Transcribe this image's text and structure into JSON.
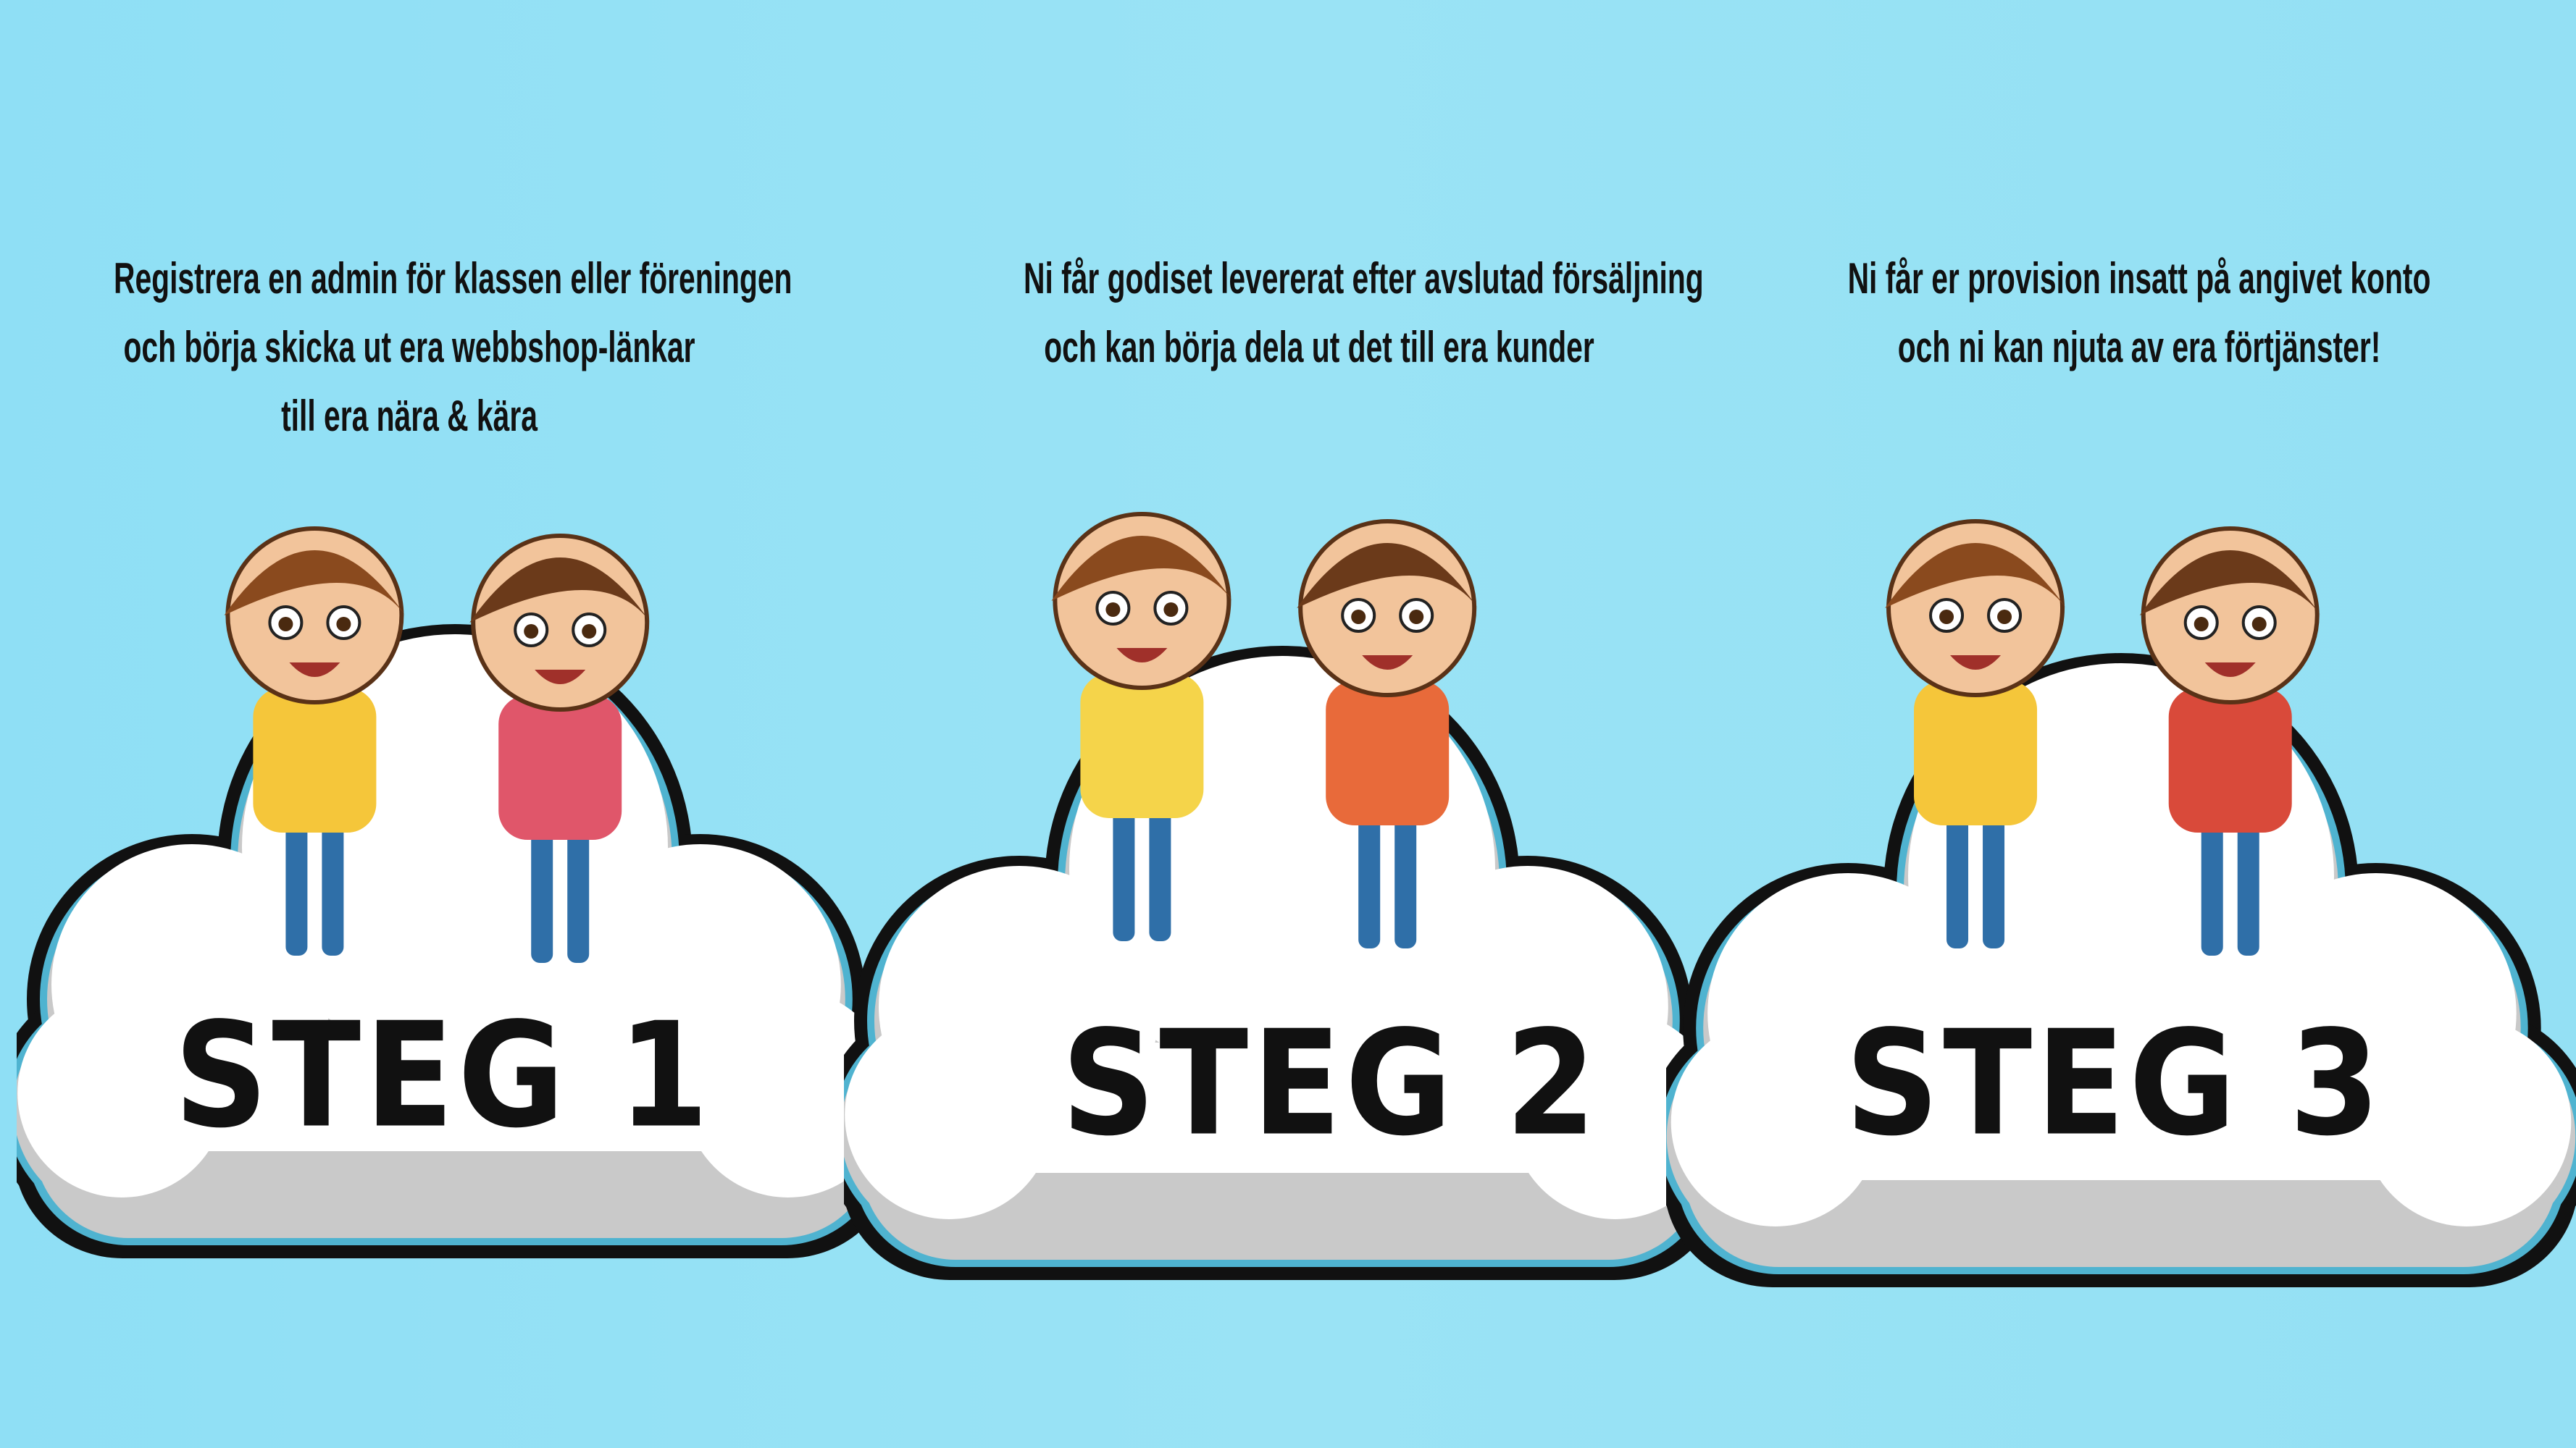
{
  "steps": [
    {
      "label": "STEG 1",
      "lines": [
        "Registrera en admin för klassen eller föreningen",
        "och börja skicka ut era webbshop-länkar",
        "till era nära & kära"
      ]
    },
    {
      "label": "STEG 2",
      "lines": [
        "Ni får godiset levererat efter avslutad försäljning",
        "och kan börja dela ut det till era kunder"
      ]
    },
    {
      "label": "STEG 3",
      "lines": [
        "Ni får er provision insatt på angivet konto",
        "och ni kan njuta av era förtjänster!"
      ]
    }
  ],
  "colors": {
    "background": "#94E0F4",
    "cloud": "#FFFFFF",
    "cloud_shadow": "#C9C9C9",
    "cloud_accent": "#4FB3D0",
    "text": "#111111"
  }
}
